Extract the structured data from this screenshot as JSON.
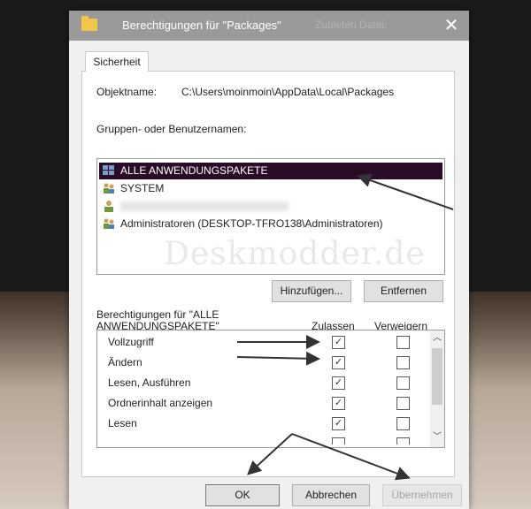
{
  "window": {
    "title": "Berechtigungen für \"Packages\"",
    "ghost_text": "Zubieten    Datei:",
    "close_glyph": "✕"
  },
  "tabs": [
    {
      "label": "Sicherheit"
    }
  ],
  "object": {
    "label": "Objektname:",
    "value": "C:\\Users\\moinmoin\\AppData\\Local\\Packages"
  },
  "groups": {
    "label": "Gruppen- oder Benutzernamen:",
    "items": [
      {
        "label": "ALLE ANWENDUNGSPAKETE",
        "icon": "app-packages-icon",
        "selected": true
      },
      {
        "label": "SYSTEM",
        "icon": "group-icon"
      },
      {
        "label": "",
        "icon": "user-icon",
        "redacted": true
      },
      {
        "label": "Administratoren (DESKTOP-TFRO138\\Administratoren)",
        "icon": "group-icon"
      }
    ]
  },
  "watermark": "Deskmodder.de",
  "buttons": {
    "add": "Hinzufügen...",
    "remove": "Entfernen",
    "ok": "OK",
    "cancel": "Abbrechen",
    "apply": "Übernehmen"
  },
  "permissions": {
    "header_line1": "Berechtigungen für \"ALLE",
    "header_line2": "ANWENDUNGSPAKETE\"",
    "allow_label": "Zulassen",
    "deny_label": "Verweigern",
    "check_glyph": "✓",
    "rows": [
      {
        "name": "Vollzugriff",
        "allow": true,
        "deny": false
      },
      {
        "name": "Ändern",
        "allow": true,
        "deny": false
      },
      {
        "name": "Lesen, Ausführen",
        "allow": true,
        "deny": false
      },
      {
        "name": "Ordnerinhalt anzeigen",
        "allow": true,
        "deny": false
      },
      {
        "name": "Lesen",
        "allow": true,
        "deny": false
      }
    ]
  },
  "colors": {
    "selection": "#2a0c28",
    "titlebar": "#9a9a9a",
    "annotation": "#333333"
  }
}
